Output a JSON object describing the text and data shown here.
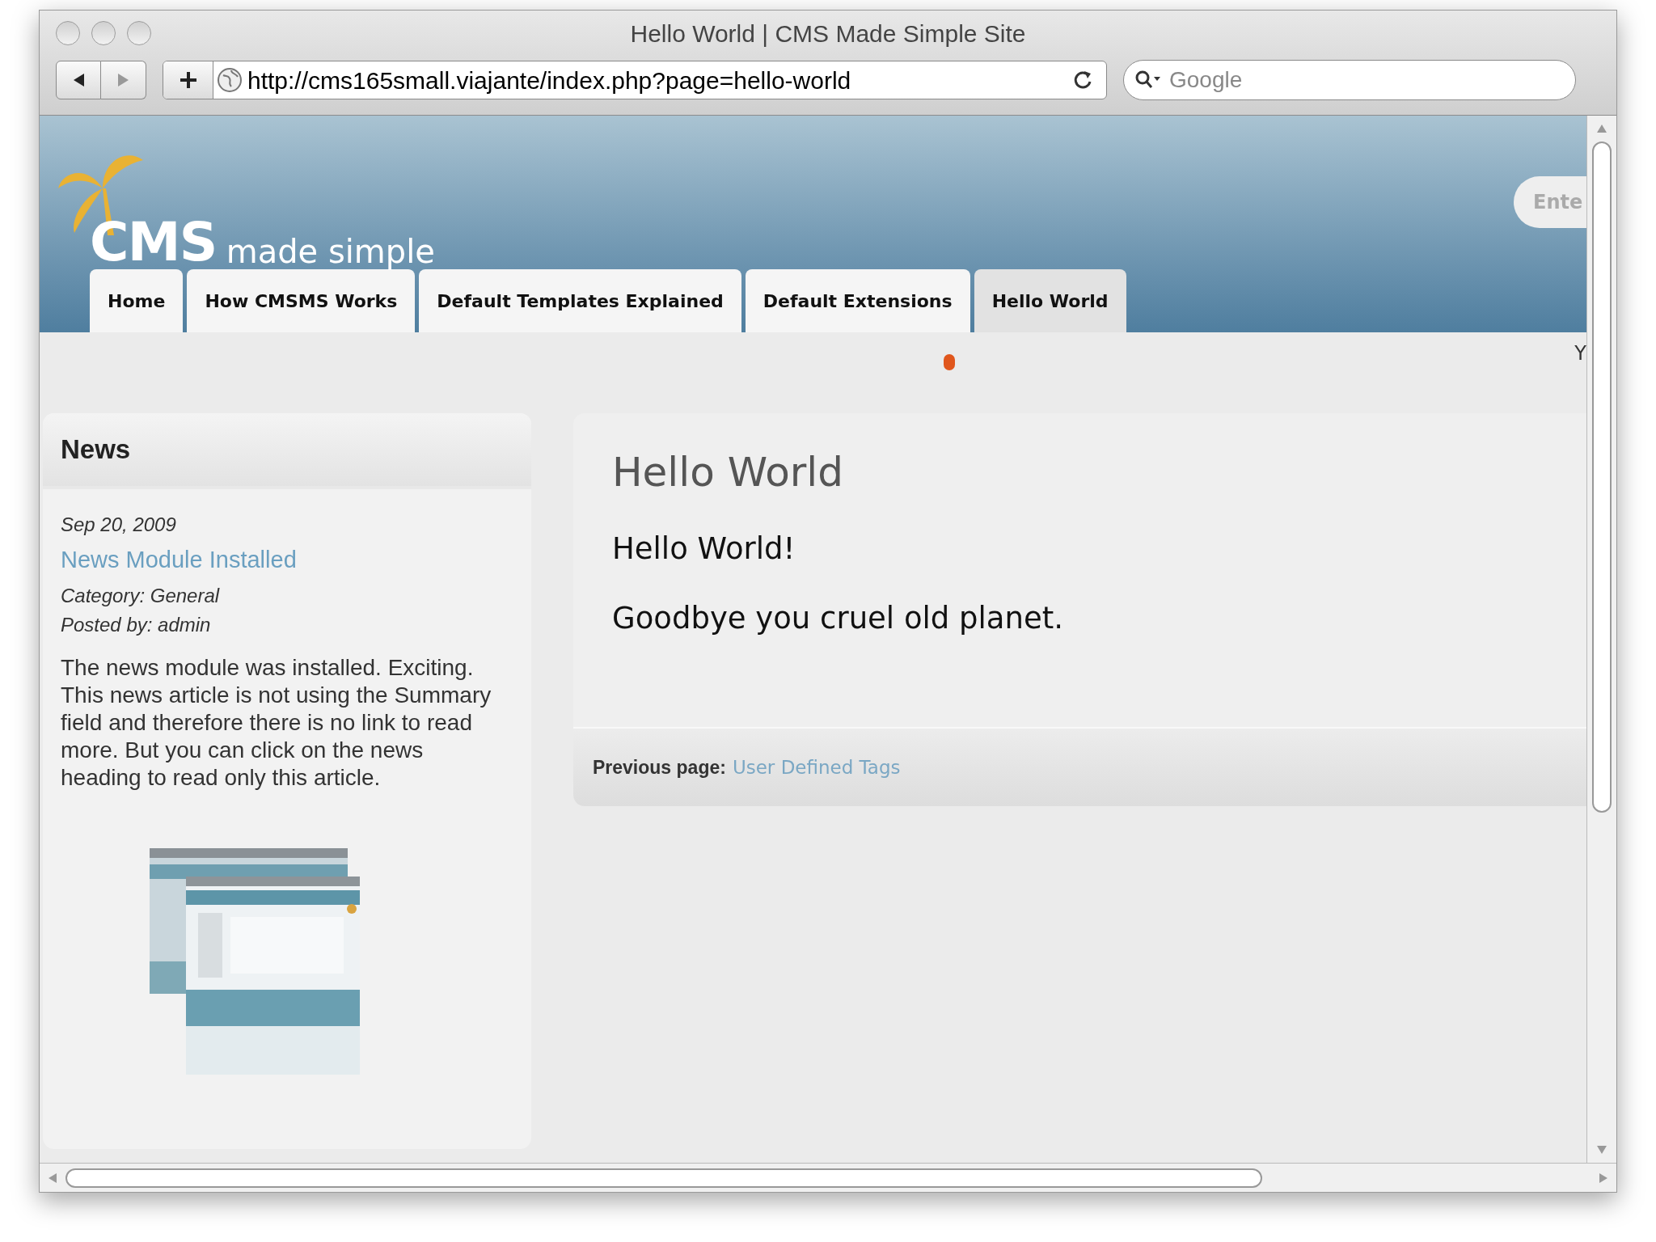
{
  "window": {
    "title": "Hello World | CMS Made Simple Site"
  },
  "toolbar": {
    "url": "http://cms165small.viajante/index.php?page=hello-world",
    "search": {
      "placeholder": "Google"
    }
  },
  "header": {
    "logo": {
      "mark": "CMS",
      "tagline": "made simple"
    },
    "search_field": {
      "value": "Ente"
    }
  },
  "tabs": [
    {
      "label": "Home",
      "selected": false
    },
    {
      "label": "How CMSMS Works",
      "selected": false
    },
    {
      "label": "Default Templates Explained",
      "selected": false
    },
    {
      "label": "Default Extensions",
      "selected": false
    },
    {
      "label": "Hello World",
      "selected": true
    }
  ],
  "band": {
    "edge_text": "Y"
  },
  "news": {
    "heading": "News",
    "items": [
      {
        "date": "Sep 20, 2009",
        "title": "News Module Installed",
        "category": "Category: General",
        "posted_by": "Posted by: admin",
        "body": "The news module was installed. Exciting. This news article is not using the Summary field and therefore there is no link to read more. But you can click on the news heading to read only this article."
      }
    ]
  },
  "content": {
    "heading": "Hello World",
    "paragraphs": [
      "Hello World!",
      "Goodbye you cruel old planet."
    ],
    "previous": {
      "label": "Previous page:",
      "link": "User Defined Tags"
    }
  }
}
